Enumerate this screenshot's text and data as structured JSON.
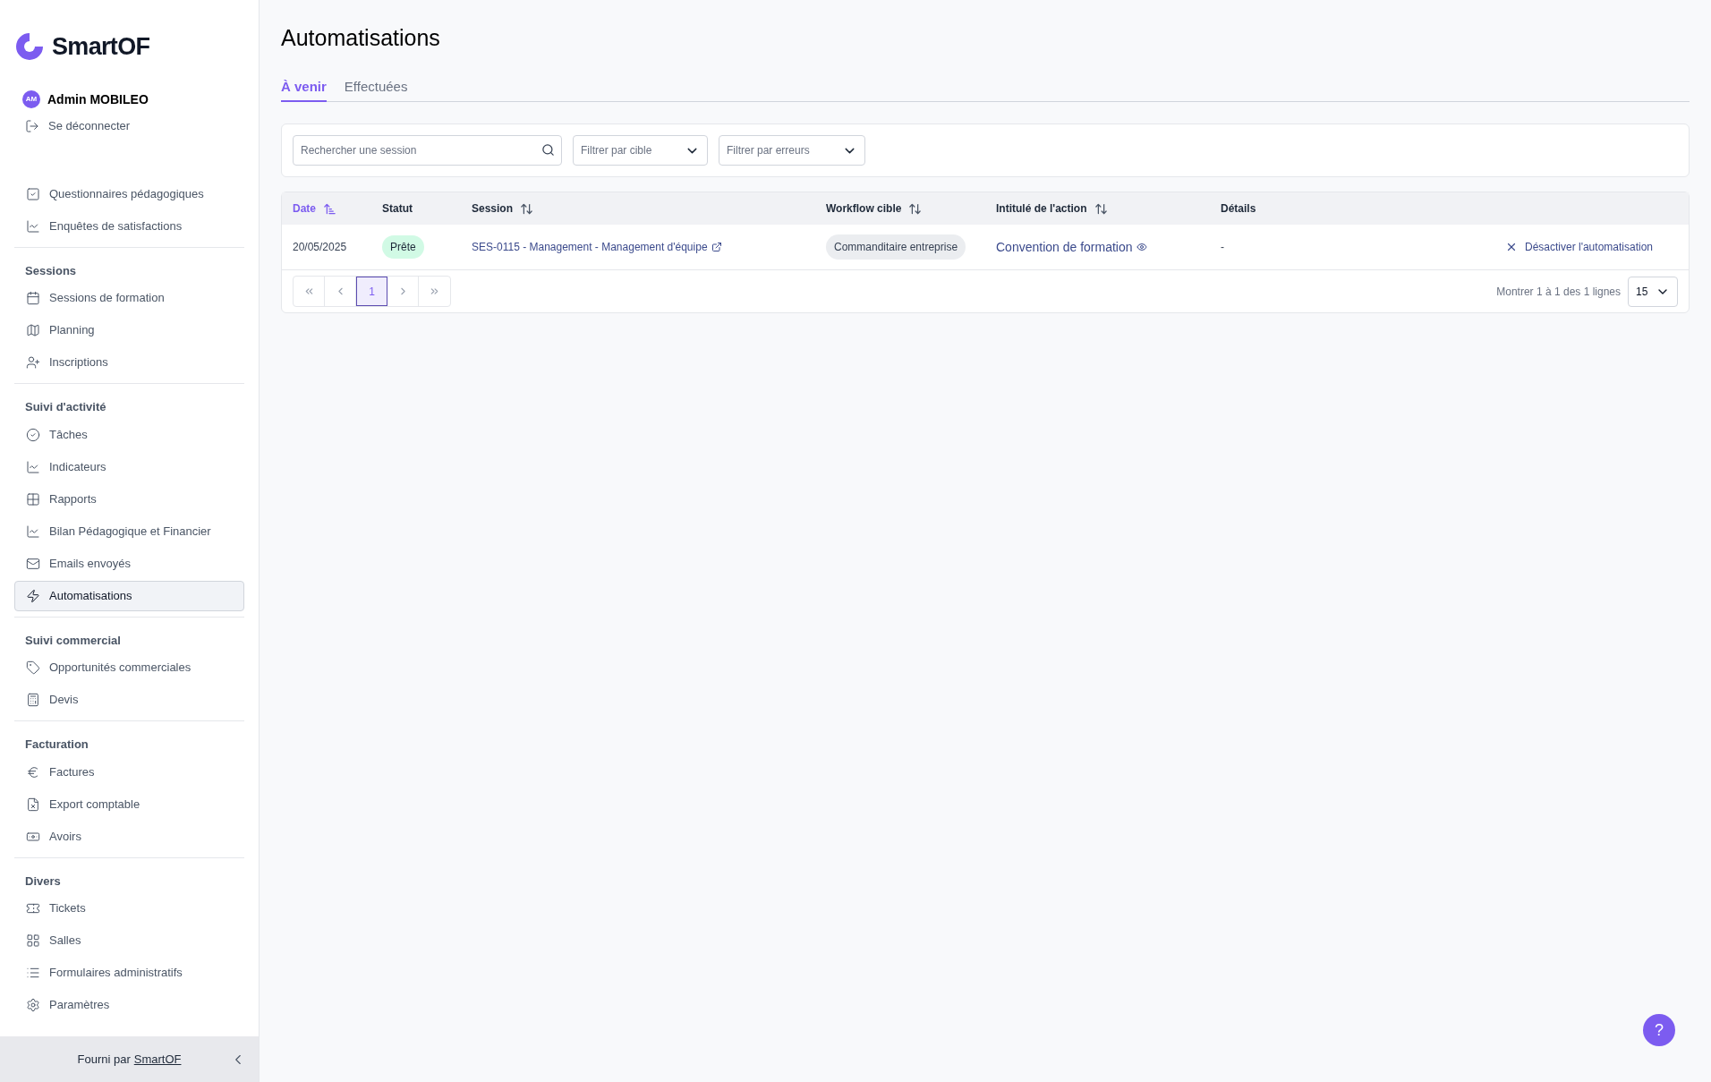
{
  "sidebar": {
    "logo": "SmartOF",
    "user": {
      "initials": "AM",
      "name": "Admin MOBILEO"
    },
    "logout": "Se déconnecter",
    "sections": [
      {
        "items": [
          {
            "label": "Questionnaires pédagogiques",
            "selected": false
          },
          {
            "label": "Enquêtes de satisfactions",
            "selected": false
          }
        ]
      },
      {
        "title": "Sessions",
        "items": [
          {
            "label": "Sessions de formation",
            "selected": false
          },
          {
            "label": "Planning",
            "selected": false
          },
          {
            "label": "Inscriptions",
            "selected": false
          }
        ]
      },
      {
        "title": "Suivi d'activité",
        "items": [
          {
            "label": "Tâches",
            "selected": false
          },
          {
            "label": "Indicateurs",
            "selected": false
          },
          {
            "label": "Rapports",
            "selected": false
          },
          {
            "label": "Bilan Pédagogique et Financier",
            "selected": false
          },
          {
            "label": "Emails envoyés",
            "selected": false
          },
          {
            "label": "Automatisations",
            "selected": true
          }
        ]
      },
      {
        "title": "Suivi commercial",
        "items": [
          {
            "label": "Opportunités commerciales",
            "selected": false
          },
          {
            "label": "Devis",
            "selected": false
          }
        ]
      },
      {
        "title": "Facturation",
        "items": [
          {
            "label": "Factures",
            "selected": false
          },
          {
            "label": "Export comptable",
            "selected": false
          },
          {
            "label": "Avoirs",
            "selected": false
          }
        ]
      },
      {
        "title": "Divers",
        "items": [
          {
            "label": "Tickets",
            "selected": false
          },
          {
            "label": "Salles",
            "selected": false
          },
          {
            "label": "Formulaires administratifs",
            "selected": false
          },
          {
            "label": "Paramètres",
            "selected": false
          }
        ]
      }
    ],
    "footer": {
      "text": "Fourni par",
      "link": "SmartOF"
    }
  },
  "page": {
    "title": "Automatisations",
    "tabs": [
      {
        "label": "À venir",
        "selected": true
      },
      {
        "label": "Effectuées",
        "selected": false
      }
    ],
    "search": {
      "placeholder": "Rechercher une session"
    },
    "filters": [
      {
        "placeholder": "Filtrer par cible"
      },
      {
        "placeholder": "Filtrer par erreurs"
      }
    ],
    "table": {
      "columns": [
        {
          "label": "Date",
          "sortable": true,
          "sorted": true
        },
        {
          "label": "Statut",
          "sortable": false,
          "sorted": false
        },
        {
          "label": "Session",
          "sortable": true,
          "sorted": false
        },
        {
          "label": "Workflow cible",
          "sortable": true,
          "sorted": false
        },
        {
          "label": "Intitulé de l'action",
          "sortable": true,
          "sorted": false
        },
        {
          "label": "Détails",
          "sortable": false,
          "sorted": false
        }
      ],
      "rows": [
        {
          "date": "20/05/2025",
          "status": "Prête",
          "session": "SES-0115 - Management - Management d'équipe",
          "workflow": "Commanditaire entreprise",
          "action": "Convention de formation",
          "details": "-",
          "button": "Désactiver l'automatisation"
        }
      ]
    },
    "pagination": {
      "pages": [
        {
          "label": "1",
          "selected": true
        }
      ],
      "summary": "Montrer 1 à 1 des 1 lignes",
      "page_size": "15"
    },
    "help": "?"
  }
}
